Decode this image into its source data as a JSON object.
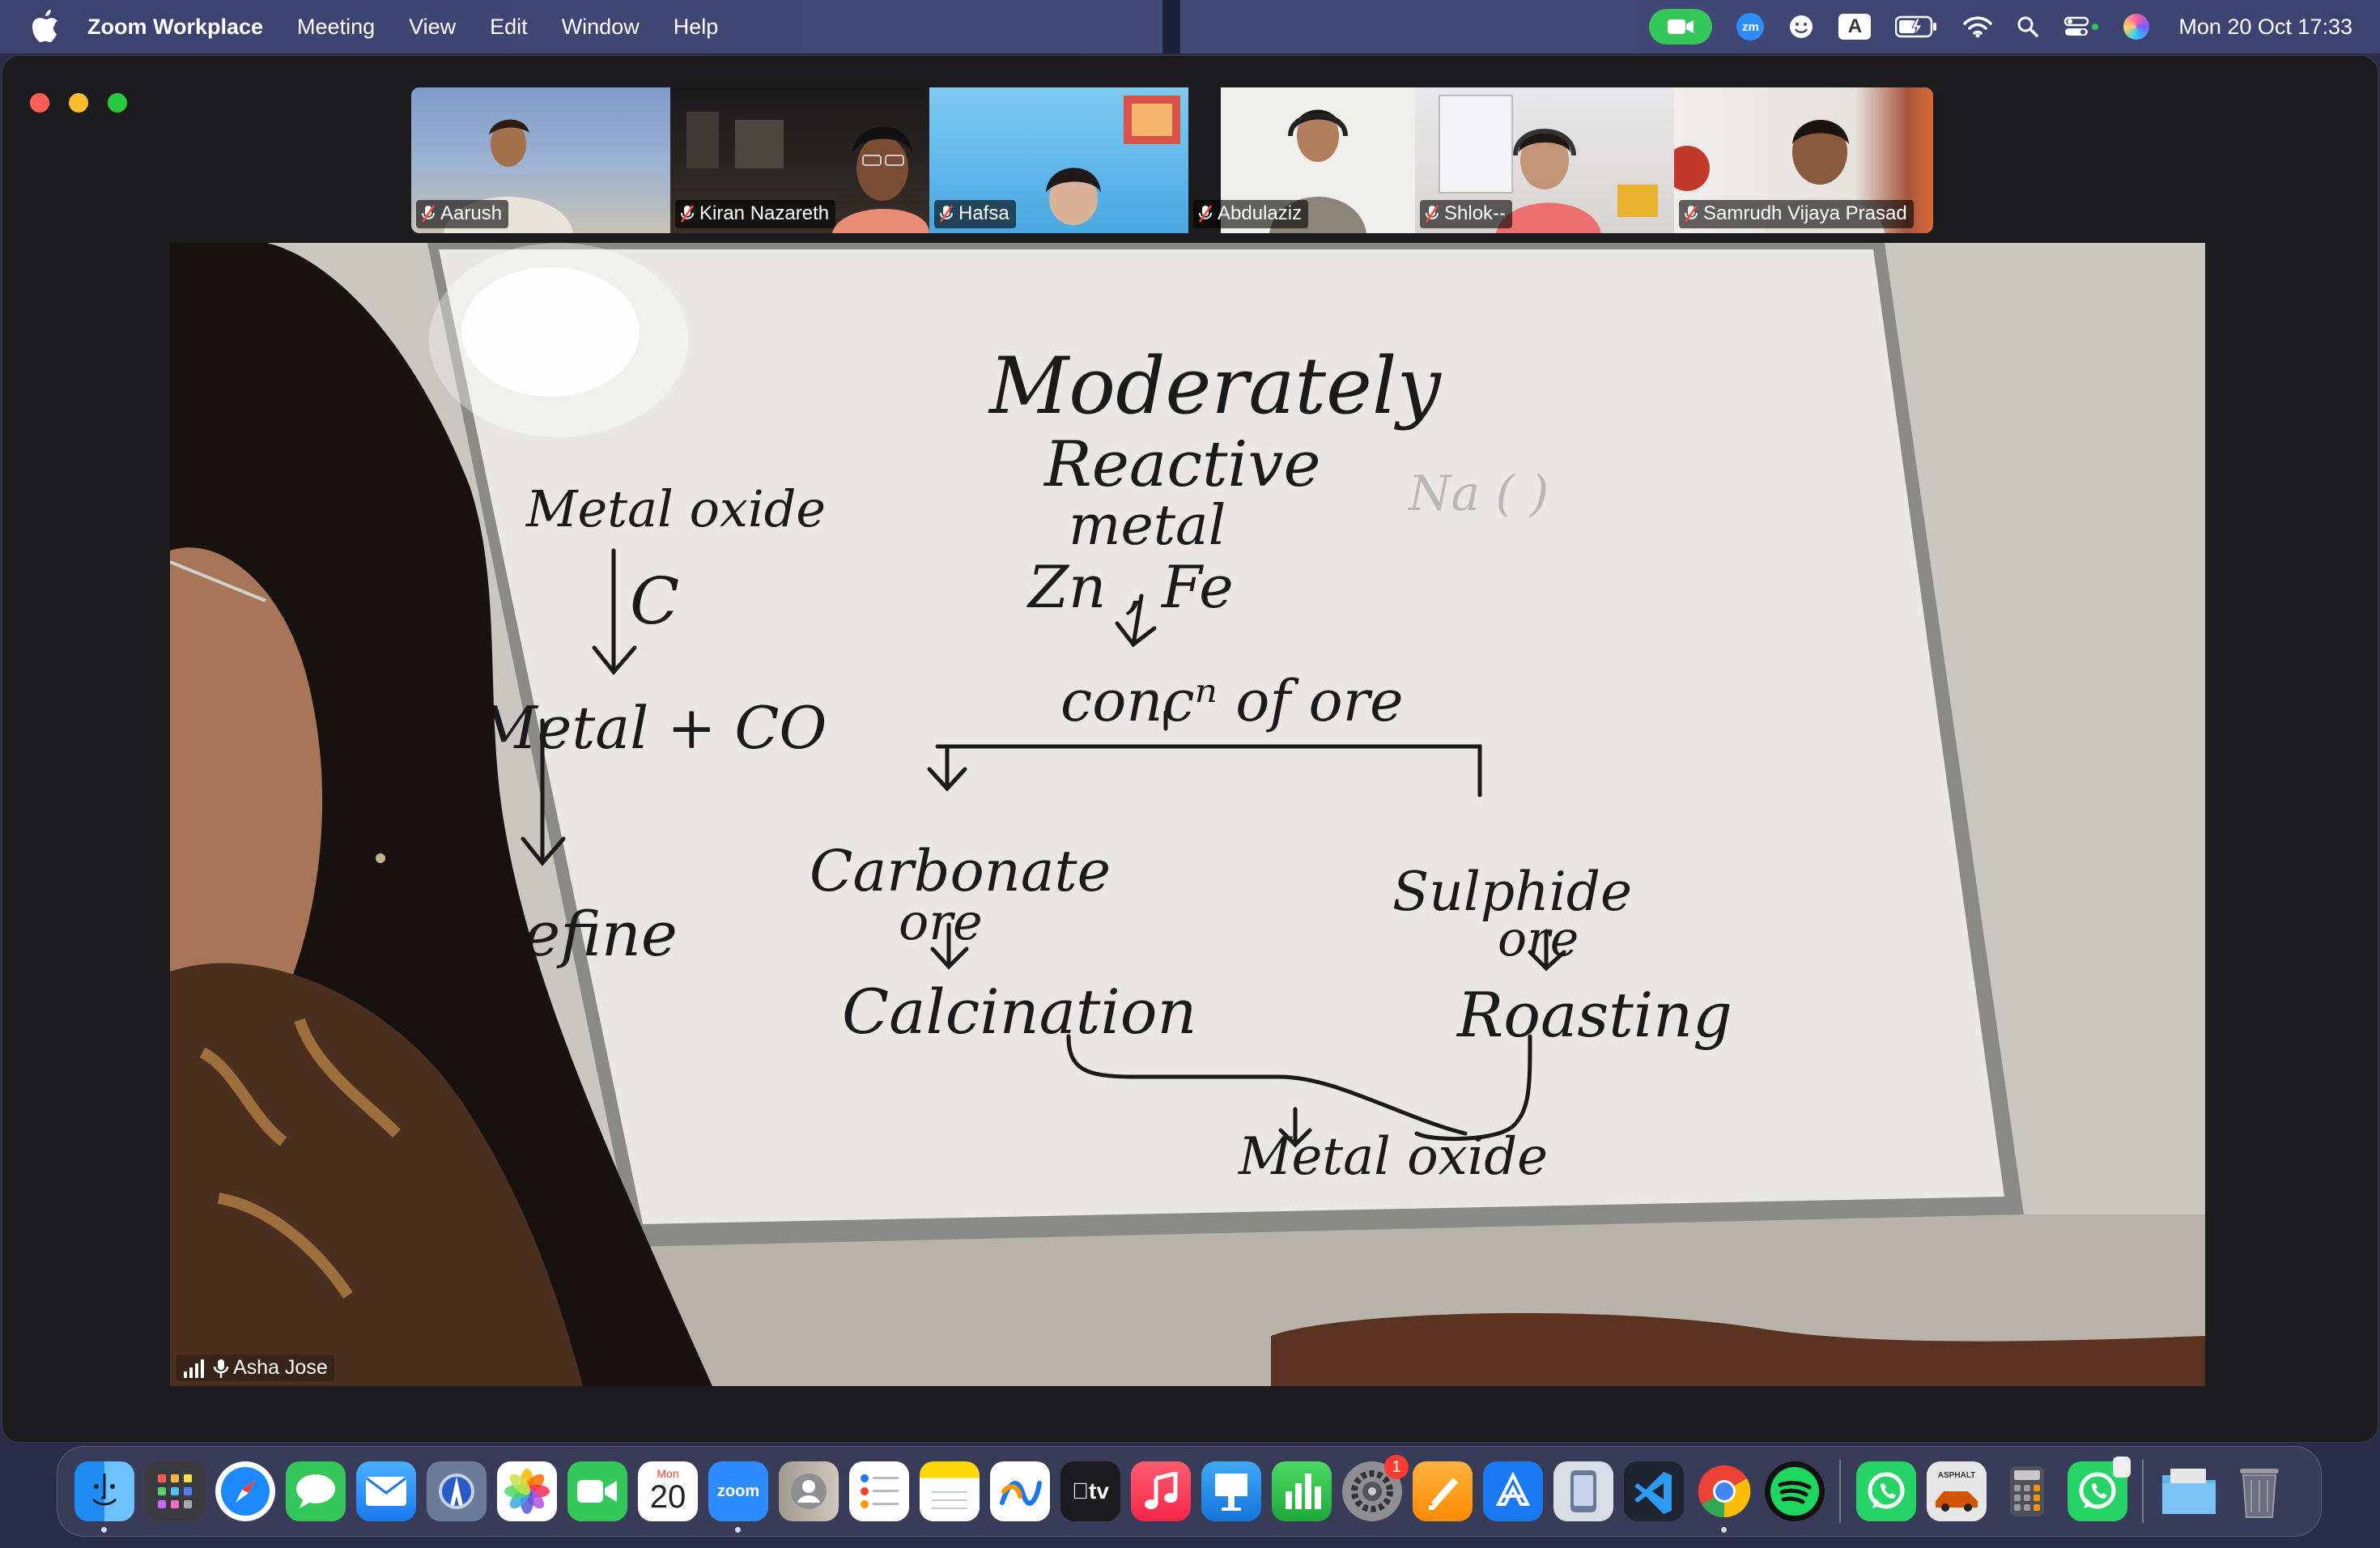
{
  "menubar": {
    "app_name": "Zoom Workplace",
    "menus": [
      "Meeting",
      "View",
      "Edit",
      "Window",
      "Help"
    ],
    "status_icons": [
      "zoom-camera-icon",
      "zoom-status-icon",
      "emoji-icon",
      "input-source-icon",
      "battery-icon",
      "wifi-icon",
      "spotlight-search-icon",
      "control-center-icon",
      "siri-icon"
    ],
    "input_source": "A",
    "zm_label": "zm",
    "clock": "Mon 20 Oct  17:33"
  },
  "participants": [
    {
      "name": "Aarush",
      "muted": true
    },
    {
      "name": "Kiran Nazareth",
      "muted": true
    },
    {
      "name": "Hafsa",
      "muted": true
    },
    {
      "name": "Abdulaziz",
      "muted": true
    },
    {
      "name": "Shlok--",
      "muted": true
    },
    {
      "name": "Samrudh Vijaya Prasad",
      "muted": true
    }
  ],
  "main_video": {
    "speaker": "Asha Jose",
    "whiteboard": {
      "title": "Moderately",
      "title2": "Reactive",
      "title3": "metal",
      "examples": "Zn , Fe",
      "step1": "concⁿ of ore",
      "left_branch": "Carbonate",
      "left_branch2": "ore",
      "left_process": "Calcination",
      "right_branch": "Sulphide",
      "right_branch2": "ore",
      "right_process": "Roasting",
      "result": "Metal oxide",
      "side_top": "Metal oxide",
      "side_reagent": "C",
      "side_product": "Metal + CO",
      "side_final": "Refine",
      "faint_note": "Na ( )"
    }
  },
  "dock": {
    "apps": [
      "Finder",
      "Launchpad",
      "Safari",
      "Messages",
      "Mail",
      "Preview",
      "Photos",
      "FaceTime",
      "Calendar",
      "Zoom",
      "Contacts",
      "Reminders",
      "Notes",
      "Freeform",
      "TV",
      "Music",
      "Keynote",
      "Numbers",
      "System Settings",
      "Pages",
      "Xcode",
      "Simulator",
      "Visual Studio Code",
      "Chrome",
      "Spotify",
      "WhatsApp",
      "Asphalt",
      "Calculator",
      "WhatsApp Beta",
      "Downloads",
      "Trash"
    ],
    "calendar_month": "Mon",
    "calendar_day": "20",
    "zoom_label": "zoom",
    "tv_label": "tv",
    "settings_badge": "1",
    "asphalt_label": "ASPHALT"
  }
}
